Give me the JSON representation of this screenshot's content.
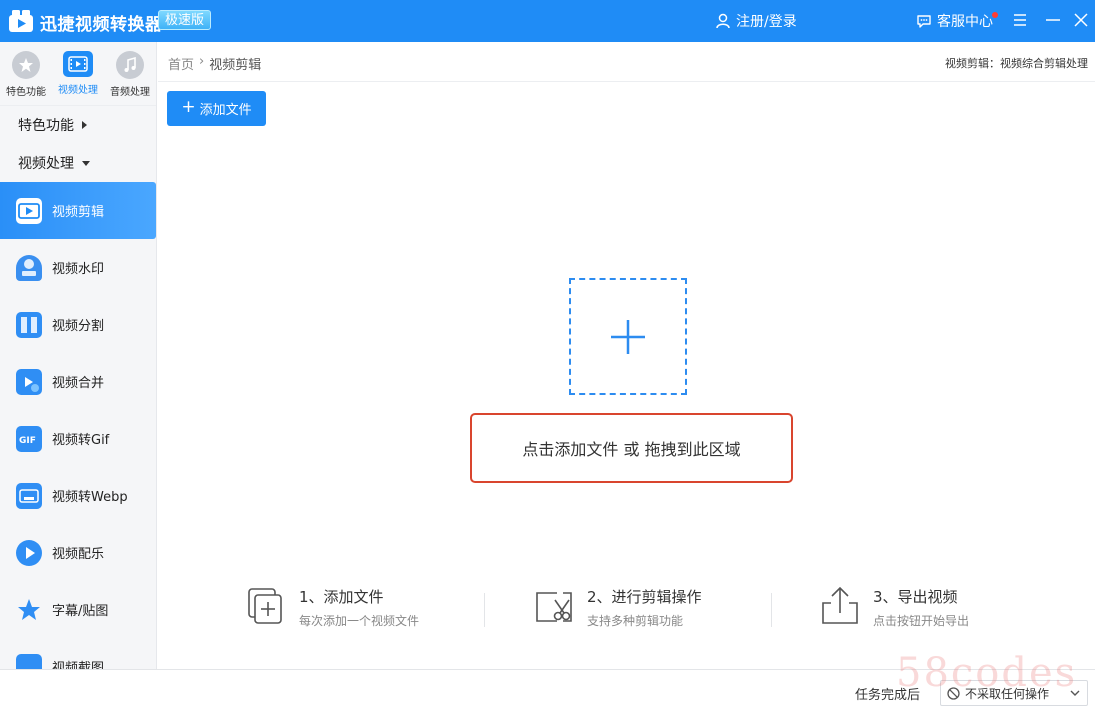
{
  "app": {
    "name": "迅捷视频转换器",
    "edition": "极速版",
    "login_label": "注册/登录",
    "service_label": "客服中心"
  },
  "sidebar": {
    "category_tabs": [
      {
        "label": "特色功能",
        "icon": "star-icon"
      },
      {
        "label": "视频处理",
        "icon": "film-icon",
        "active": true
      },
      {
        "label": "音频处理",
        "icon": "music-note-icon"
      }
    ],
    "groups": [
      {
        "label": "特色功能",
        "expanded": false
      },
      {
        "label": "视频处理",
        "expanded": true
      }
    ],
    "items": [
      {
        "label": "视频剪辑",
        "icon": "video-clip-icon",
        "active": true
      },
      {
        "label": "视频水印",
        "icon": "stamp-icon"
      },
      {
        "label": "视频分割",
        "icon": "split-icon"
      },
      {
        "label": "视频合并",
        "icon": "merge-icon"
      },
      {
        "label": "视频转Gif",
        "icon": "gif-icon"
      },
      {
        "label": "视频转Webp",
        "icon": "webp-icon"
      },
      {
        "label": "视频配乐",
        "icon": "music-play-icon"
      },
      {
        "label": "字幕/贴图",
        "icon": "sticker-icon"
      },
      {
        "label": "视频截图",
        "icon": "screenshot-icon"
      }
    ]
  },
  "breadcrumb": {
    "home": "首页",
    "separator": "›",
    "current": "视频剪辑"
  },
  "header": {
    "description": "视频剪辑：视频综合剪辑处理"
  },
  "main": {
    "add_button": "添加文件",
    "drop_hint": "点击添加文件 或 拖拽到此区域"
  },
  "steps": [
    {
      "title": "1、添加文件",
      "subtitle": "每次添加一个视频文件",
      "icon": "add-file-icon"
    },
    {
      "title": "2、进行剪辑操作",
      "subtitle": "支持多种剪辑功能",
      "icon": "cut-icon"
    },
    {
      "title": "3、导出视频",
      "subtitle": "点击按钮开始导出",
      "icon": "export-icon"
    }
  ],
  "footer": {
    "after_label": "任务完成后",
    "after_value": "不采取任何操作"
  },
  "watermark": "58codes",
  "colors": {
    "accent": "#1f8cf6",
    "highlight_border": "#d9452e"
  }
}
